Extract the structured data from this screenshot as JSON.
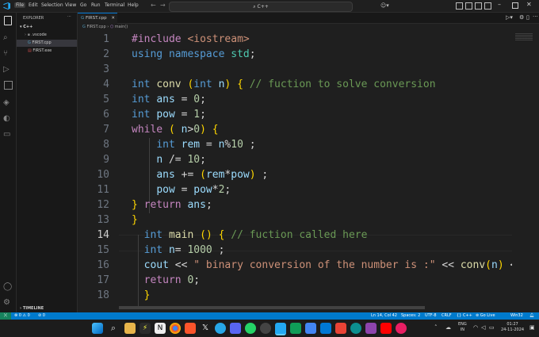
{
  "menu": [
    "File",
    "Edit",
    "Selection",
    "View",
    "Go",
    "Run",
    "Terminal",
    "Help"
  ],
  "command_center": "C++",
  "sidebar": {
    "title": "EXPLORER",
    "folder": "C++",
    "items": [
      ".vscode",
      "FIRST.cpp",
      "FIRST.exe"
    ],
    "timeline": "TIMELINE"
  },
  "tab": {
    "label": "FIRST.cpp"
  },
  "breadcrumb": {
    "file": "FIRST.cpp",
    "symbol": "main()"
  },
  "editor": {
    "lines": [
      "#include <iostream>",
      "using namespace std;",
      "",
      "int conv (int n) { // fuction to solve conversion",
      "int ans = 0;",
      "int pow = 1;",
      "while ( n>0) {",
      "    int rem = n%10 ;",
      "    n /= 10;",
      "    ans += (rem*pow) ;",
      "    pow = pow*2;",
      "} return ans;",
      "}",
      "  int main () { // fuction called here",
      "  int n= 1000 ;",
      "  cout << \" binary conversion of the number is :\" << conv(n) <",
      "  return 0;",
      "  }"
    ],
    "line_numbers": [
      "1",
      "2",
      "3",
      "4",
      "5",
      "6",
      "7",
      "8",
      "9",
      "10",
      "11",
      "12",
      "13",
      "14",
      "15",
      "16",
      "17",
      "18"
    ],
    "current_line": 14
  },
  "status": {
    "errors": "0",
    "warnings": "0",
    "ports": "0",
    "cursor": "Ln 14, Col 42",
    "spaces": "Spaces: 2",
    "encoding": "UTF-8",
    "eol": "CRLF",
    "language": "C++",
    "golive": "Go Live",
    "platform": "Win32"
  },
  "taskbar": {
    "lang1": "ENG",
    "lang2": "IN",
    "time": "01:27",
    "date": "24-11-2024"
  },
  "colors": {
    "accent": "#007acc",
    "keyword": "#569cd6",
    "comment": "#6a9955"
  }
}
